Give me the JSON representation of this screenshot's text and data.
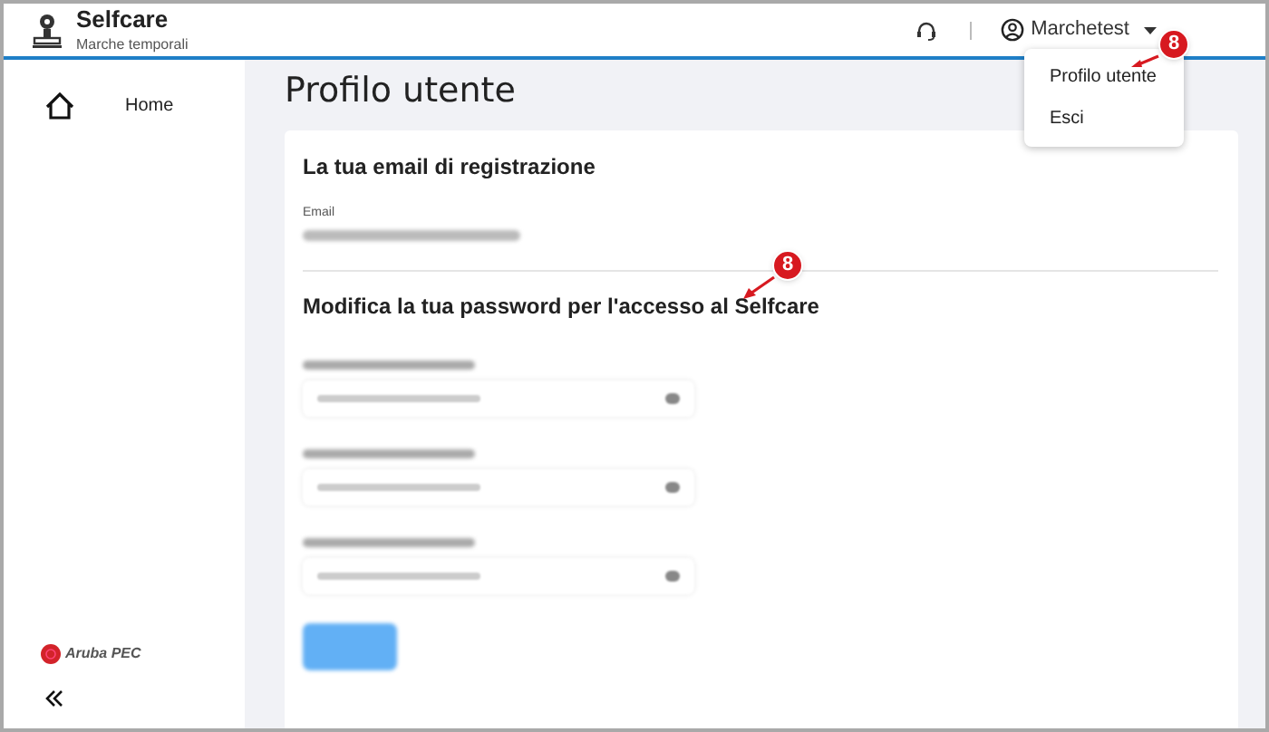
{
  "header": {
    "app_name": "Selfcare",
    "app_subtitle": "Marche temporali",
    "user_name": "Marchetest"
  },
  "user_menu": {
    "items": [
      {
        "label": "Profilo utente"
      },
      {
        "label": "Esci"
      }
    ]
  },
  "sidebar": {
    "items": [
      {
        "label": "Home",
        "selected": false
      }
    ],
    "logo_text": "Aruba PEC"
  },
  "page": {
    "title": "Profilo utente",
    "email_section": {
      "heading": "La tua email di registrazione",
      "label": "Email"
    },
    "password_section": {
      "heading": "Modifica la tua password per l'accesso al Selfcare",
      "fields": [
        {
          "redacted": true
        },
        {
          "redacted": true
        },
        {
          "redacted": true
        }
      ]
    }
  },
  "callouts": [
    {
      "label": "8"
    },
    {
      "label": "8"
    }
  ]
}
